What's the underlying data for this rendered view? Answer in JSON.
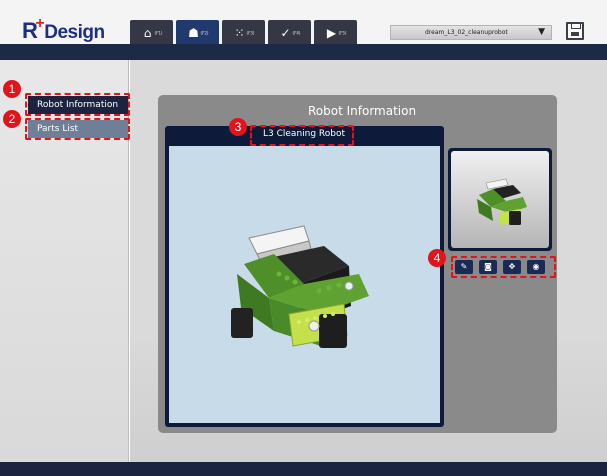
{
  "app": {
    "logo_r": "R",
    "logo_plus": "+",
    "logo_text": "Design"
  },
  "tabs": [
    {
      "icon": "home-icon",
      "glyph": "⌂",
      "label": "(F1)"
    },
    {
      "icon": "robot-user-icon",
      "glyph": "☗",
      "label": "(F2)"
    },
    {
      "icon": "grid-icon",
      "glyph": "⁙",
      "label": "(F3)"
    },
    {
      "icon": "check-icon",
      "glyph": "✓",
      "label": "(F4)"
    },
    {
      "icon": "play-icon",
      "glyph": "▶",
      "label": "(F5)"
    }
  ],
  "project_select": {
    "value": "dream_L3_02_cleanuprobot"
  },
  "sidebar": {
    "items": [
      {
        "label": "Robot Information",
        "badge": "1"
      },
      {
        "label": "Parts List",
        "badge": "2"
      }
    ]
  },
  "main": {
    "panel_title": "Robot Information",
    "viewer_title": "L3 Cleaning Robot",
    "viewer_badge": "3",
    "tools_badge": "4",
    "tools": [
      {
        "icon": "edit-icon",
        "glyph": "✎"
      },
      {
        "icon": "camera-icon",
        "glyph": "◙"
      },
      {
        "icon": "move-icon",
        "glyph": "✥"
      },
      {
        "icon": "eye-icon",
        "glyph": "◉"
      }
    ]
  },
  "colors": {
    "accent": "#213a6e",
    "highlight": "#e0141a",
    "robot_green": "#5a9a2a",
    "robot_lime": "#c4e04a"
  }
}
